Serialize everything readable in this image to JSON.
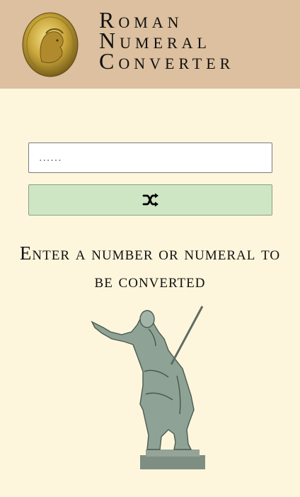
{
  "header": {
    "title_lines": [
      "Roman",
      "Numeral",
      "Converter"
    ],
    "coin_image": "gold-roman-coin"
  },
  "converter": {
    "input_placeholder": "......",
    "input_value": "",
    "random_icon": "shuffle-icon"
  },
  "message": {
    "text": "Enter a number or numeral to be converted"
  },
  "illustration": {
    "image": "augustus-statue"
  },
  "colors": {
    "header_bg": "#dcc09f",
    "page_bg": "#fdf6dc",
    "button_bg": "#cfe6c5",
    "text": "#111111"
  }
}
